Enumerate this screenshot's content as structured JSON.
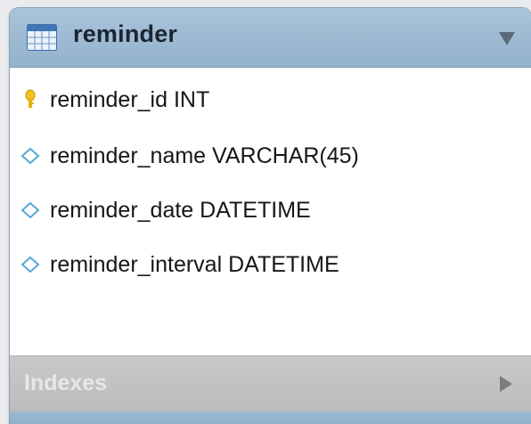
{
  "table": {
    "name": "reminder",
    "icon": "table-grid-icon",
    "collapse_icon": "triangle-down-icon"
  },
  "columns": [
    {
      "label": "reminder_id INT",
      "icon": "primary-key-icon"
    },
    {
      "label": "reminder_name VARCHAR(45)",
      "icon": "column-diamond-icon"
    },
    {
      "label": "reminder_date DATETIME",
      "icon": "column-diamond-icon"
    },
    {
      "label": "reminder_interval DATETIME",
      "icon": "column-diamond-icon"
    }
  ],
  "indexes": {
    "label": "Indexes",
    "expand_icon": "triangle-right-icon"
  },
  "colors": {
    "header": "#9fbcd6",
    "indexes_bar": "#c2c2c2",
    "key_icon": "#f1c21b",
    "diamond_icon": "#5aa8d8"
  }
}
